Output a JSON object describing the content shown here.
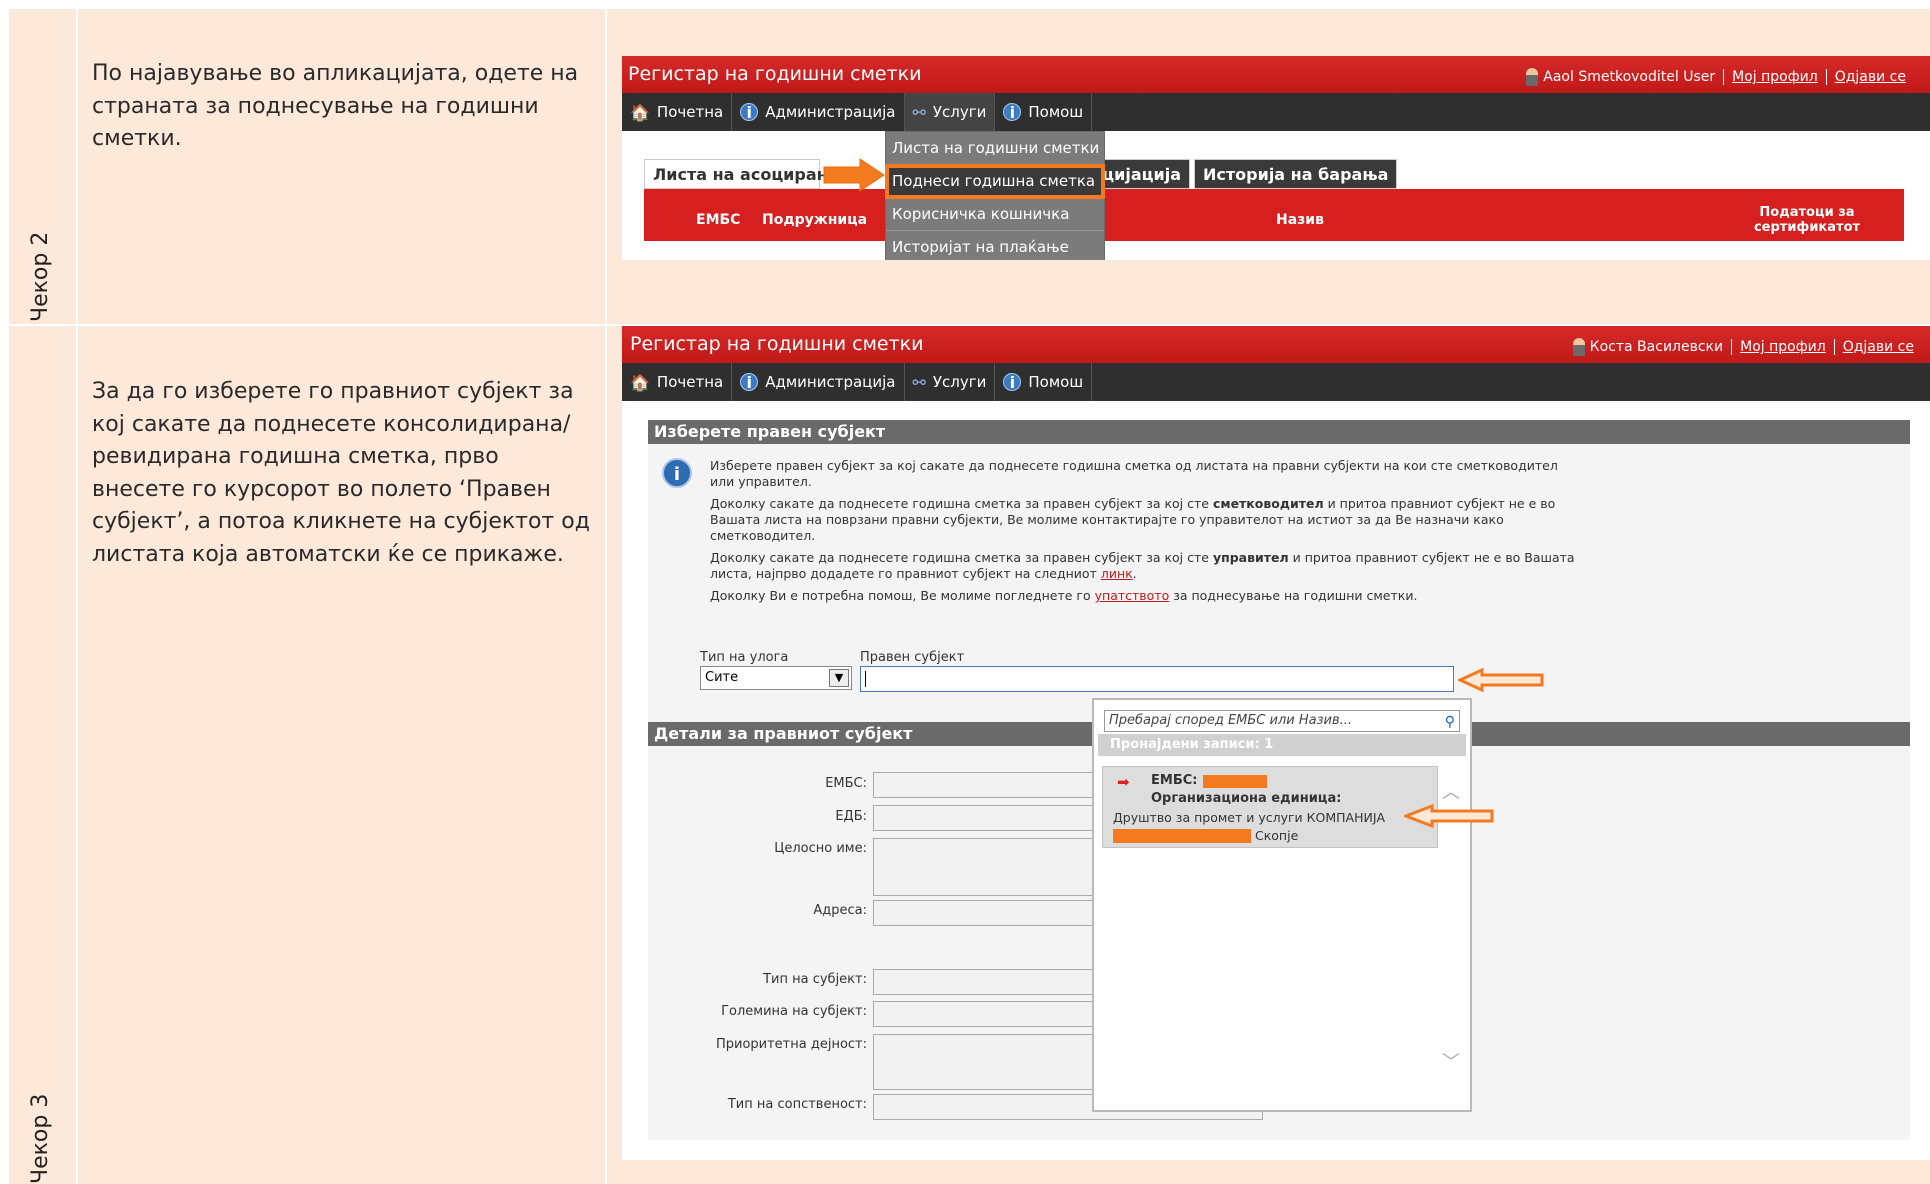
{
  "steps": [
    {
      "label": "Чекор 2",
      "text": "По најавување во апликацијата, одете на страната за поднесување на годишни сметки."
    },
    {
      "label": "Чекор 3",
      "text": "За да го изберете го правниот субјект за кој сакате да поднесете консолидирана/ревидирана годишна сметка, прво внесете го курсорот во полето ‘Правен субјект’, а потоа кликнете на субјектот од листата која автоматски ќе се прикаже."
    }
  ],
  "shot1": {
    "app_title": "Регистар на годишни сметки",
    "user_name": "Aaol Smetkovoditel User",
    "profile_link": "Мој профил",
    "logout_link": "Одјави се",
    "nav": [
      "Почетна",
      "Администрација",
      "Услуги",
      "Помош"
    ],
    "dropdown": [
      "Листа на годишни сметки",
      "Поднеси годишна сметка",
      "Корисничка кошничка",
      "Историјат на плаќање"
    ],
    "tabs": [
      "Листа на асоцирани",
      "а за асоцијација",
      "Историја на барања"
    ],
    "grid_headers": [
      "ЕМБС",
      "Подружница",
      "Назив",
      "Податоци за сертификатот"
    ]
  },
  "shot2": {
    "app_title": "Регистар на годишни сметки",
    "user_name": "Коста Василевски",
    "profile_link": "Мој профил",
    "logout_link": "Одјави се",
    "nav": [
      "Почетна",
      "Администрација",
      "Услуги",
      "Помош"
    ],
    "section1_title": "Изберете правен субјект",
    "info_p1": "Изберете правен субјект за кој сакате да поднесете годишна сметка од листата на правни субјекти на кои сте сметководител или управител.",
    "info_p2_a": "Доколку сакате да поднесете годишна сметка за правен субјект за кој сте ",
    "info_p2_b": "сметководител",
    "info_p2_c": " и притоа правниот субјект не е во Вашата листа на поврзани правни субјекти, Ве молиме контактирајте го управителот на истиот за да Ве назначи како сметководител.",
    "info_p3_a": "Доколку сакате да поднесете годишна сметка за правен субјект за кој сте ",
    "info_p3_b": "управител",
    "info_p3_c": " и притоа правниот субјект не е во Вашата листа, најпрво додадете го правниот субјект на следниот ",
    "info_p3_link": "линк",
    "info_p3_d": ".",
    "info_p4_a": "Доколку Ви е потребна помош, Ве молиме погледнете го ",
    "info_p4_link": "упатството",
    "info_p4_b": " за поднесување на годишни сметки.",
    "role_label": "Тип на улога",
    "role_value": "Сите",
    "entity_label": "Правен субјект",
    "section2_title": "Детали за правниот субјект",
    "form_labels": [
      "ЕМБС:",
      "ЕДБ:",
      "Целосно име:",
      "Адреса:",
      "Тип на субјект:",
      "Големина на субјект:",
      "Приоритетна дејност:",
      "Тип на сопственост:"
    ],
    "popup_placeholder": "Пребарај според ЕМБС или Назив...",
    "popup_found": "Пронајдени записи: 1",
    "result_embs_label": "ЕМБС:",
    "result_org_label": "Организациона единица:",
    "result_name": "Друштво за промет и услуги КОМПАНИЈА",
    "result_city": "Скопје"
  },
  "colors": {
    "background": "#fde9d9",
    "header_red": "#c11818",
    "nav_dark": "#2f2f2f",
    "highlight_orange": "#f47a20"
  }
}
